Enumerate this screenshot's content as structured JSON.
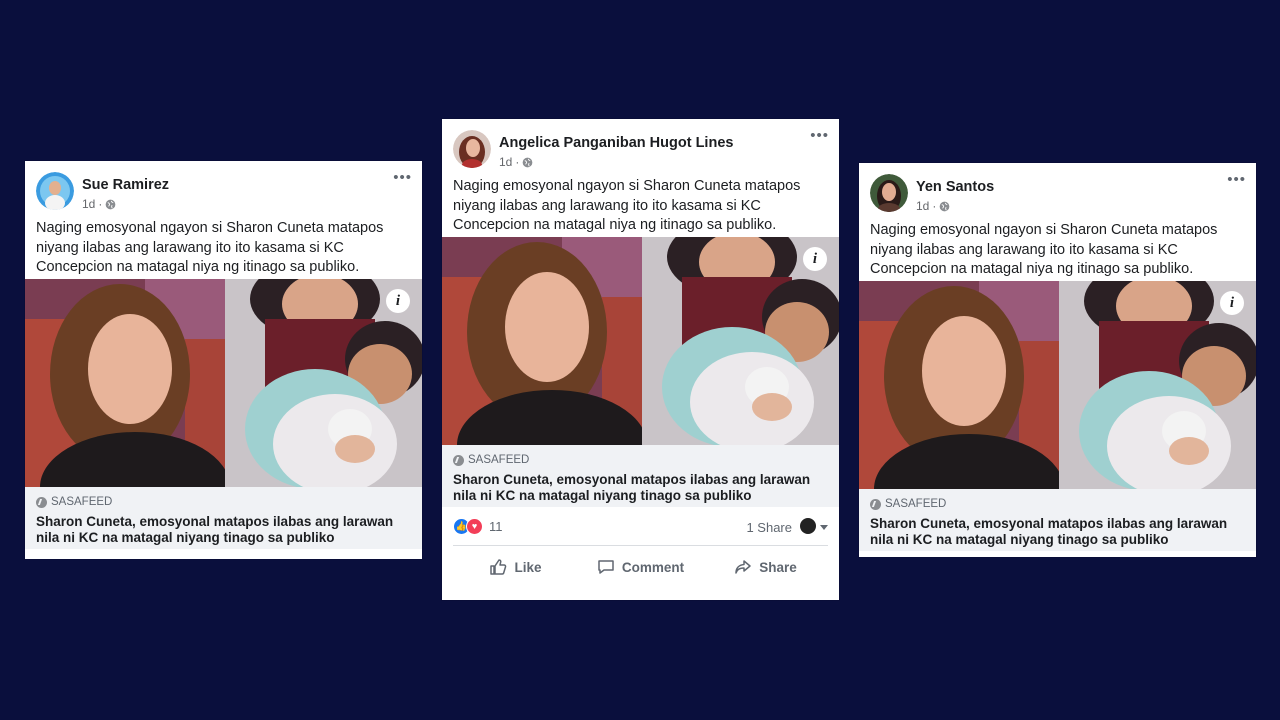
{
  "posts": [
    {
      "author": "Sue Ramirez",
      "time": "1d",
      "text": "Naging emosyonal ngayon si Sharon Cuneta matapos niyang ilabas ang larawang ito ito kasama si KC Concepcion na matagal niya ng itinago sa publiko.",
      "link_domain": "SASAFEED",
      "link_title": "Sharon Cuneta, emosyonal matapos ilabas ang larawan nila ni KC na matagal niyang tinago sa publiko"
    },
    {
      "author": "Angelica Panganiban Hugot Lines",
      "time": "1d",
      "text": "Naging emosyonal ngayon si Sharon Cuneta matapos niyang ilabas ang larawang ito ito kasama si KC Concepcion na matagal niya ng itinago sa publiko.",
      "link_domain": "SASAFEED",
      "link_title": "Sharon Cuneta, emosyonal matapos ilabas ang larawan nila ni KC na matagal niyang tinago sa publiko",
      "reaction_count": "11",
      "share_count": "1 Share",
      "actions": {
        "like": "Like",
        "comment": "Comment",
        "share": "Share"
      }
    },
    {
      "author": "Yen Santos",
      "time": "1d",
      "text": "Naging emosyonal ngayon si Sharon Cuneta matapos niyang ilabas ang larawang ito ito kasama si KC Concepcion na matagal niya ng itinago sa publiko.",
      "link_domain": "SASAFEED",
      "link_title": "Sharon Cuneta, emosyonal matapos ilabas ang larawan nila ni KC na matagal niyang tinago sa publiko"
    }
  ],
  "icons": {
    "more": "more-options-icon",
    "privacy": "globe-icon",
    "info": "info-icon",
    "like": "thumbs-up-icon",
    "comment": "comment-icon",
    "share": "share-arrow-icon"
  },
  "colors": {
    "background": "#0a0f3d",
    "like_blue": "#1877f2",
    "love_red": "#f33e58"
  }
}
